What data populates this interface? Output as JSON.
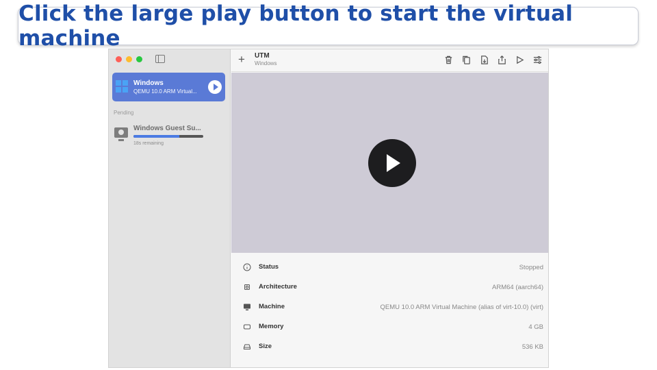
{
  "banner": {
    "text": "Click the large play button to start the virtual machine"
  },
  "sidebar": {
    "vm": {
      "name": "Windows",
      "subtitle": "QEMU 10.0 ARM Virtual..."
    },
    "pending_label": "Pending",
    "download": {
      "name": "Windows Guest Su...",
      "remaining": "18s remaining",
      "progress": 0.66
    }
  },
  "toolbar": {
    "add_label": "+",
    "title": "UTM",
    "subtitle": "Windows",
    "icons": [
      "trash-icon",
      "clone-icon",
      "download-icon",
      "share-icon",
      "run-icon",
      "settings-icon"
    ]
  },
  "details": [
    {
      "icon": "info-icon",
      "label": "Status",
      "value": "Stopped"
    },
    {
      "icon": "cpu-icon",
      "label": "Architecture",
      "value": "ARM64 (aarch64)"
    },
    {
      "icon": "monitor-icon",
      "label": "Machine",
      "value": "QEMU 10.0 ARM Virtual Machine (alias of virt-10.0) (virt)"
    },
    {
      "icon": "memory-icon",
      "label": "Memory",
      "value": "4 GB"
    },
    {
      "icon": "drive-icon",
      "label": "Size",
      "value": "536 KB"
    }
  ],
  "colors": {
    "accent": "#5a7ad6",
    "banner_text": "#1f4fa8",
    "preview_bg": "#cecbd6"
  }
}
